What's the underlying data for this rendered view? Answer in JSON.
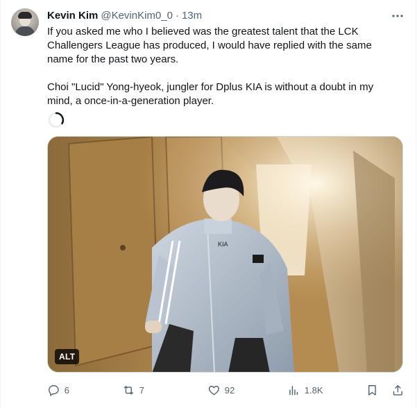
{
  "tweet": {
    "author": {
      "name": "Kevin Kim",
      "handle": "@KevinKim0_0"
    },
    "separator": "·",
    "timestamp": "13m",
    "paragraphs": [
      "If you asked me who I believed was the greatest talent that the LCK\nChallengers League has produced, I would have replied with the same\nname for the past two years.",
      "Choi \"Lucid\" Yong-hyeok, jungler for Dplus KIA is without a doubt in my\nmind, a once-in-a-generation player."
    ],
    "media": {
      "alt_label": "ALT"
    },
    "actions": {
      "replies": "6",
      "retweets": "7",
      "likes": "92",
      "views": "1.8K"
    }
  },
  "icons": {
    "more": "more-icon",
    "reply": "reply-icon",
    "retweet": "retweet-icon",
    "like": "like-icon",
    "views": "views-icon",
    "bookmark": "bookmark-icon",
    "share": "share-icon",
    "loading": "loading-spinner-icon"
  },
  "colors": {
    "text_primary": "#0f1419",
    "text_secondary": "#536471",
    "border": "#cfd9de"
  }
}
